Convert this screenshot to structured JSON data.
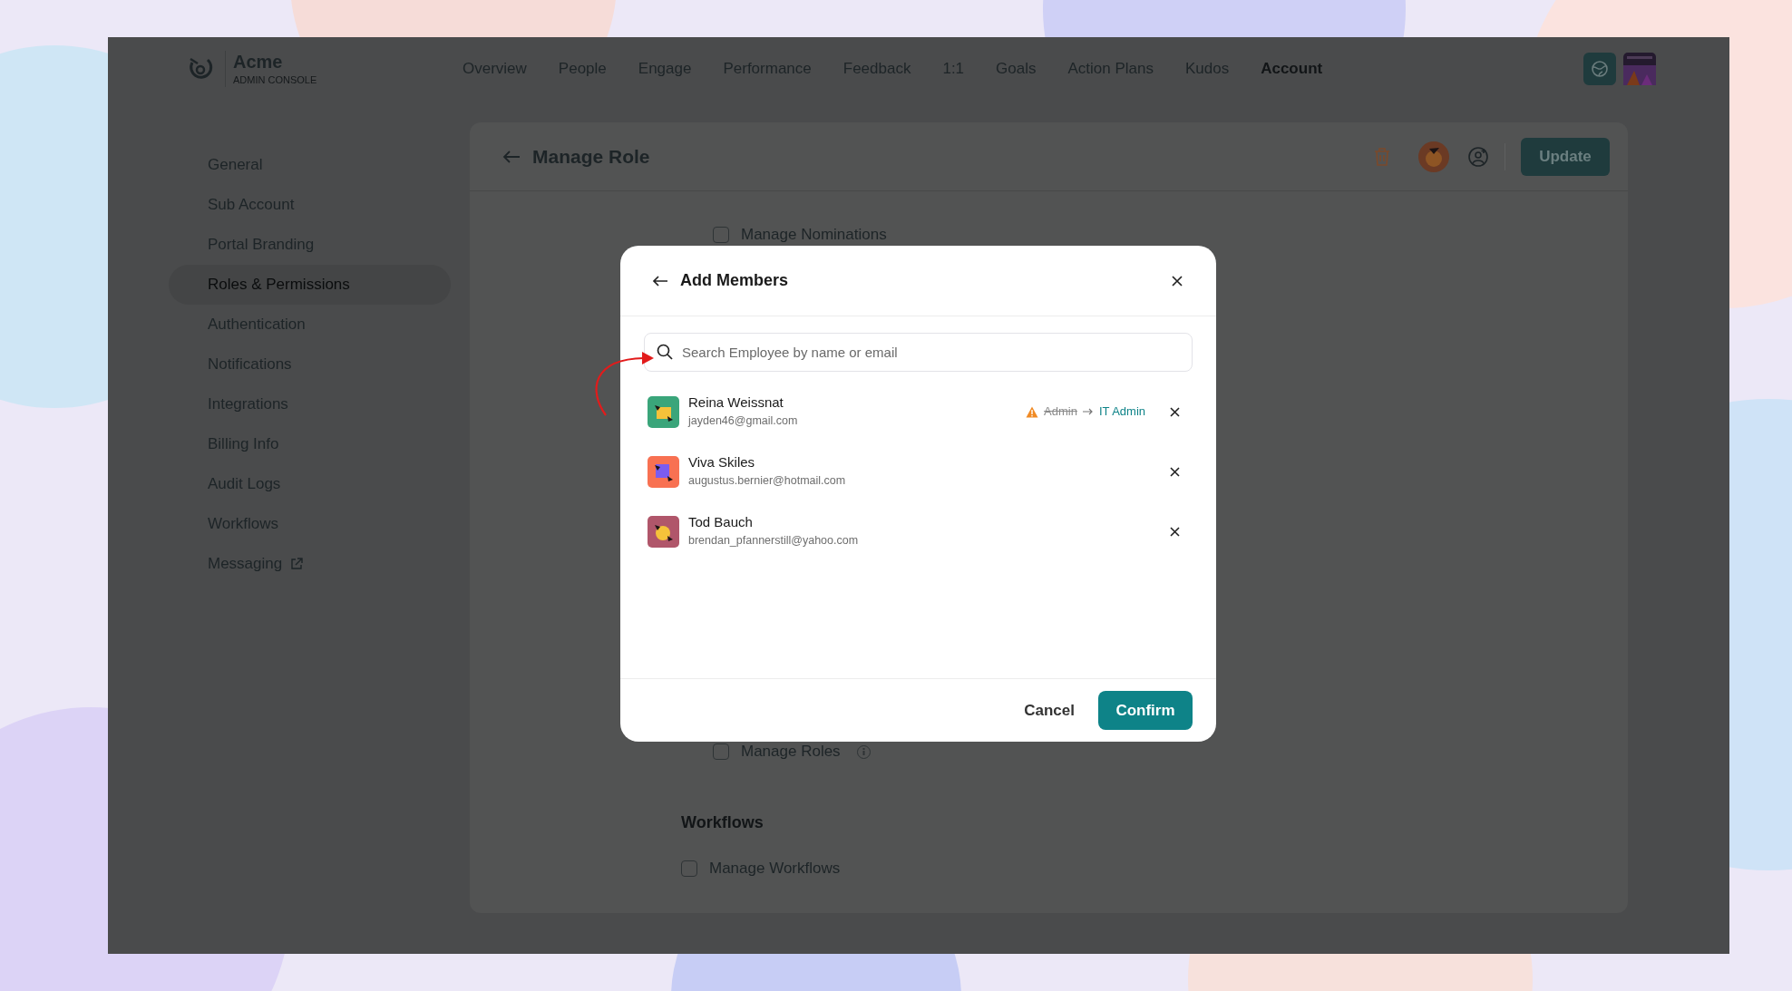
{
  "brand": {
    "name": "Acme",
    "subtitle": "ADMIN CONSOLE"
  },
  "nav": [
    {
      "label": "Overview",
      "selected": false
    },
    {
      "label": "People",
      "selected": false
    },
    {
      "label": "Engage",
      "selected": false
    },
    {
      "label": "Performance",
      "selected": false
    },
    {
      "label": "Feedback",
      "selected": false
    },
    {
      "label": "1:1",
      "selected": false
    },
    {
      "label": "Goals",
      "selected": false
    },
    {
      "label": "Action Plans",
      "selected": false
    },
    {
      "label": "Kudos",
      "selected": false
    },
    {
      "label": "Account",
      "selected": true
    }
  ],
  "sidebar": [
    {
      "label": "General",
      "selected": false,
      "external": false
    },
    {
      "label": "Sub Account",
      "selected": false,
      "external": false
    },
    {
      "label": "Portal Branding",
      "selected": false,
      "external": false
    },
    {
      "label": "Roles & Permissions",
      "selected": true,
      "external": false
    },
    {
      "label": "Authentication",
      "selected": false,
      "external": false
    },
    {
      "label": "Notifications",
      "selected": false,
      "external": false
    },
    {
      "label": "Integrations",
      "selected": false,
      "external": false
    },
    {
      "label": "Billing Info",
      "selected": false,
      "external": false
    },
    {
      "label": "Audit Logs",
      "selected": false,
      "external": false
    },
    {
      "label": "Workflows",
      "selected": false,
      "external": false
    },
    {
      "label": "Messaging",
      "selected": false,
      "external": true
    }
  ],
  "page": {
    "title": "Manage Role",
    "update_button": "Update",
    "sections": [
      {
        "items": [
          {
            "label": "Manage Nominations",
            "checked": false,
            "info": false
          },
          {
            "label": "Manage Roles",
            "checked": false,
            "info": true
          }
        ]
      },
      {
        "title": "Workflows",
        "items": [
          {
            "label": "Manage Workflows",
            "checked": false,
            "info": false
          }
        ]
      }
    ]
  },
  "modal": {
    "title": "Add Members",
    "search": {
      "placeholder": "Search Employee by name or email"
    },
    "members": [
      {
        "name": "Reina Weissnat",
        "email": "jayden46@gmail.com",
        "color": "#3aa57a",
        "role_change": {
          "from": "Admin",
          "to": "IT Admin"
        }
      },
      {
        "name": "Viva Skiles",
        "email": "augustus.bernier@hotmail.com",
        "color": "#f87152"
      },
      {
        "name": "Tod Bauch",
        "email": "brendan_pfannerstill@yahoo.com",
        "color": "#b0566a"
      }
    ],
    "cancel": "Cancel",
    "confirm": "Confirm"
  }
}
